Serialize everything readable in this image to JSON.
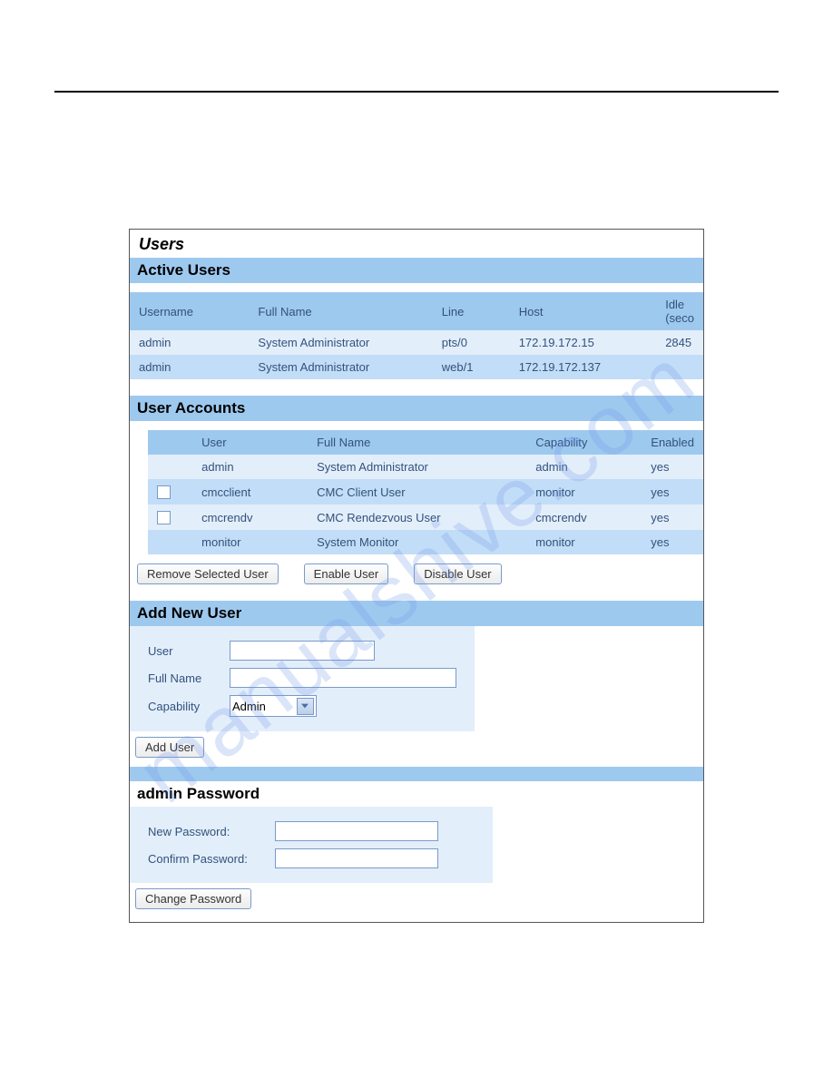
{
  "watermark": "manualshive.com",
  "panel": {
    "title": "Users",
    "activeUsers": {
      "header": "Active Users",
      "columns": [
        "Username",
        "Full Name",
        "Line",
        "Host",
        "Idle (seco"
      ],
      "rows": [
        {
          "username": "admin",
          "fullname": "System Administrator",
          "line": "pts/0",
          "host": "172.19.172.15",
          "idle": "2845"
        },
        {
          "username": "admin",
          "fullname": "System Administrator",
          "line": "web/1",
          "host": "172.19.172.137",
          "idle": ""
        }
      ]
    },
    "userAccounts": {
      "header": "User Accounts",
      "columns": [
        "",
        "User",
        "Full Name",
        "Capability",
        "Enabled"
      ],
      "rows": [
        {
          "checkbox": false,
          "user": "admin",
          "fullname": "System Administrator",
          "capability": "admin",
          "enabled": "yes"
        },
        {
          "checkbox": true,
          "user": "cmcclient",
          "fullname": "CMC Client User",
          "capability": "monitor",
          "enabled": "yes"
        },
        {
          "checkbox": true,
          "user": "cmcrendv",
          "fullname": "CMC Rendezvous User",
          "capability": "cmcrendv",
          "enabled": "yes"
        },
        {
          "checkbox": false,
          "user": "monitor",
          "fullname": "System Monitor",
          "capability": "monitor",
          "enabled": "yes"
        }
      ],
      "buttons": {
        "remove": "Remove Selected User",
        "enable": "Enable User",
        "disable": "Disable User"
      }
    },
    "addNewUser": {
      "header": "Add New User",
      "labels": {
        "user": "User",
        "fullname": "Full Name",
        "capability": "Capability"
      },
      "capability_selected": "Admin",
      "button": "Add User"
    },
    "adminPassword": {
      "header": "admin Password",
      "labels": {
        "new": "New Password:",
        "confirm": "Confirm Password:"
      },
      "button": "Change Password"
    }
  }
}
